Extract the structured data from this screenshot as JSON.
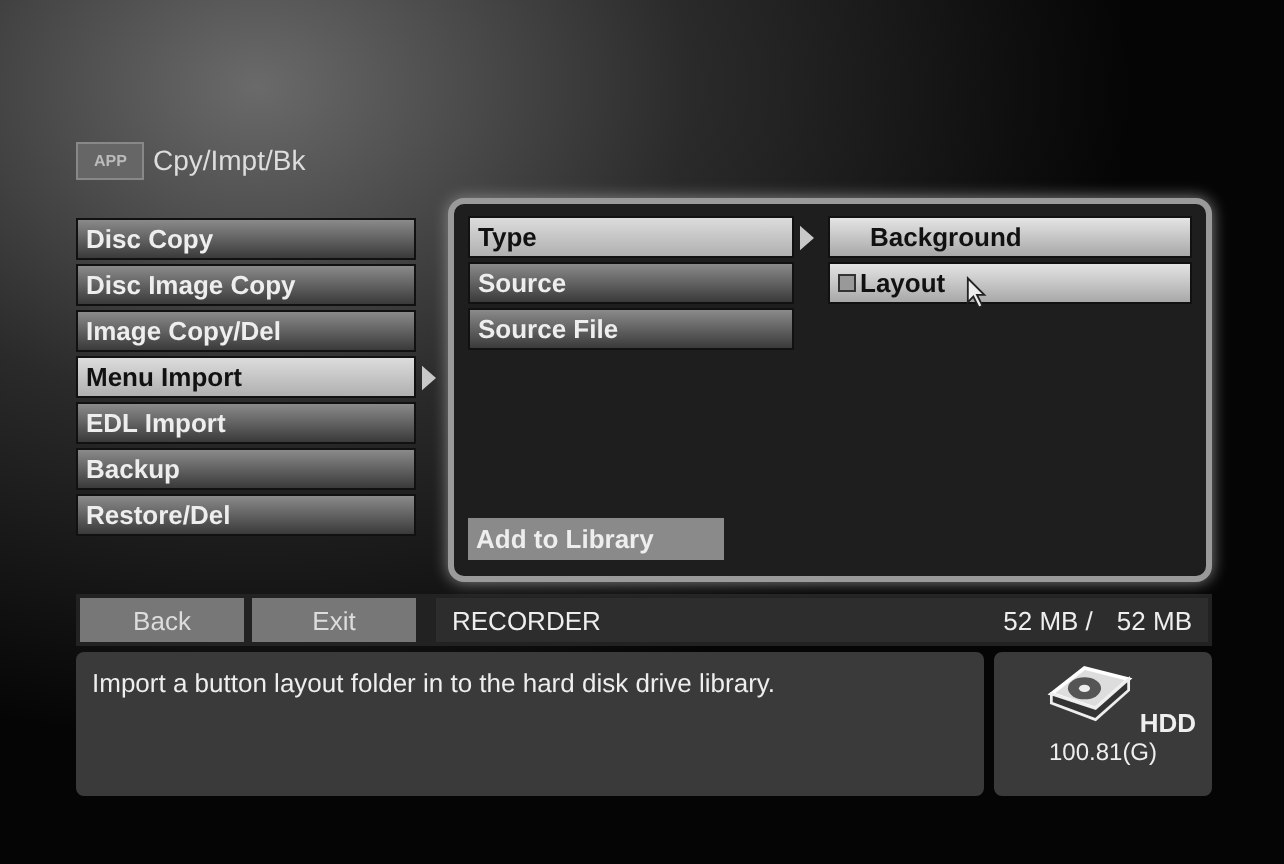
{
  "header": {
    "badge": "APP",
    "title": "Cpy/Impt/Bk"
  },
  "menu": [
    {
      "label": "Disc Copy",
      "selected": false
    },
    {
      "label": "Disc Image Copy",
      "selected": false
    },
    {
      "label": "Image Copy/Del",
      "selected": false
    },
    {
      "label": "Menu Import",
      "selected": true
    },
    {
      "label": "EDL Import",
      "selected": false
    },
    {
      "label": "Backup",
      "selected": false
    },
    {
      "label": "Restore/Del",
      "selected": false
    }
  ],
  "submenu": [
    {
      "label": "Type",
      "selected": true
    },
    {
      "label": "Source",
      "selected": false
    },
    {
      "label": "Source File",
      "selected": false
    }
  ],
  "options": [
    {
      "label": "Background",
      "checked": false
    },
    {
      "label": "Layout",
      "checked": true
    }
  ],
  "add_button": "Add to Library",
  "footer": {
    "buttons": [
      "Back",
      "Exit"
    ],
    "device": "RECORDER",
    "used": "52 MB /",
    "total": "52 MB"
  },
  "description": "Import a button layout folder in to the hard disk drive library.",
  "drive": {
    "label": "HDD",
    "capacity": "100.81(G)"
  }
}
